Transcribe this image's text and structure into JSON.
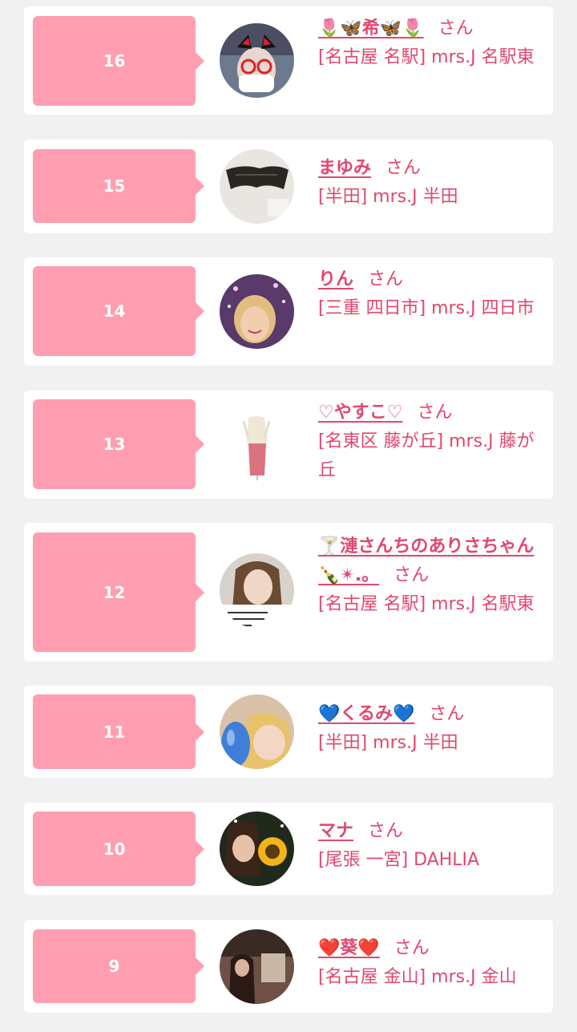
{
  "cast": [
    {
      "rank": "16",
      "name": "🌷🦋希🦋🌷",
      "suffix": "さん",
      "location": "[名古屋 名駅] mrs.J 名駅東",
      "avatar": "avatar-masked-woman"
    },
    {
      "rank": "15",
      "name": "まゆみ",
      "suffix": "さん",
      "location": "[半田] mrs.J 半田",
      "avatar": "avatar-lingerie"
    },
    {
      "rank": "14",
      "name": "りん",
      "suffix": "さん",
      "location": "[三重 四日市] mrs.J 四日市",
      "avatar": "avatar-blonde-woman"
    },
    {
      "rank": "13",
      "name": "♡やすこ♡",
      "suffix": "さん",
      "location": "[名東区 藤が丘] mrs.J 藤が丘",
      "avatar": "avatar-dress"
    },
    {
      "rank": "12",
      "name": "🍸漣さんちのありさちゃん🍾✴︎.。",
      "suffix": "さん",
      "location": "[名古屋 名駅] mrs.J 名駅東",
      "avatar": "avatar-selfie-text"
    },
    {
      "rank": "11",
      "name": "💙くるみ💙",
      "suffix": "さん",
      "location": "[半田] mrs.J 半田",
      "avatar": "avatar-balloon"
    },
    {
      "rank": "10",
      "name": "マナ",
      "suffix": "さん",
      "location": "[尾張 一宮] DAHLIA",
      "avatar": "avatar-sunflower"
    },
    {
      "rank": "9",
      "name": "❤️葵❤️",
      "suffix": "さん",
      "location": "[名古屋 金山] mrs.J 金山",
      "avatar": "avatar-shop"
    }
  ]
}
